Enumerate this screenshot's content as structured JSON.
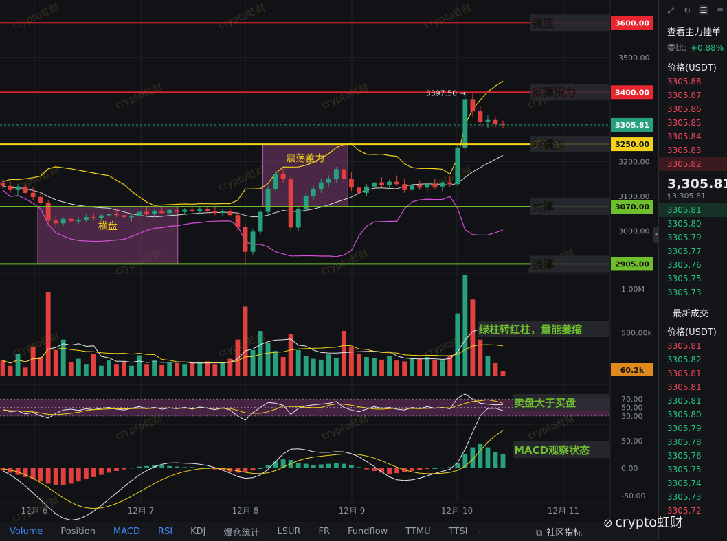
{
  "chart_data": {
    "type": "candlestick",
    "price_axis": {
      "ticks": [
        3000,
        3100,
        3200,
        3300,
        3400,
        3500
      ],
      "tick_labels": [
        "3000.00",
        "3100.00",
        "3200.00",
        "3300.00",
        "3400.00",
        "3500.00"
      ],
      "range": [
        2890,
        3650
      ]
    },
    "x_ticks": [
      "12月 6",
      "12月 7",
      "12月 8",
      "12月 9",
      "12月 10",
      "12月 11"
    ],
    "current_price": {
      "value": 3305.81,
      "label": "3305.81"
    },
    "high_marker": {
      "value": 3397.5,
      "label": "3397.50"
    },
    "levels": [
      {
        "name": "强压",
        "price": 3600,
        "price_label": "3600.00",
        "color": "#e8262f"
      },
      {
        "name": "反弹压力",
        "price": 3400,
        "price_label": "3400.00",
        "color": "#e8262f"
      },
      {
        "name": "关键位",
        "price": 3250,
        "price_label": "3250.00",
        "color": "#f2d21b"
      },
      {
        "name": "支撑",
        "price": 3070,
        "price_label": "3070.00",
        "color": "#6fbf2d"
      },
      {
        "name": "强撑",
        "price": 2905,
        "price_label": "2905.00",
        "color": "#6fbf2d"
      }
    ],
    "zones": [
      {
        "label": "横盘",
        "x0": 0.07,
        "x1": 0.35,
        "y0": 3070,
        "y1": 2905
      },
      {
        "label": "震荡蓄力",
        "x0": 0.52,
        "x1": 0.69,
        "y0": 3250,
        "y1": 3070
      }
    ],
    "candles": [
      [
        3140,
        3150,
        3120,
        3130
      ],
      [
        3130,
        3145,
        3110,
        3118
      ],
      [
        3118,
        3135,
        3100,
        3128
      ],
      [
        3128,
        3140,
        3105,
        3110
      ],
      [
        3110,
        3125,
        3090,
        3098
      ],
      [
        3098,
        3110,
        3075,
        3082
      ],
      [
        3082,
        3090,
        3015,
        3030
      ],
      [
        3030,
        3045,
        3010,
        3022
      ],
      [
        3022,
        3040,
        3015,
        3035
      ],
      [
        3035,
        3045,
        3022,
        3028
      ],
      [
        3028,
        3040,
        3020,
        3032
      ],
      [
        3032,
        3048,
        3025,
        3040
      ],
      [
        3040,
        3052,
        3032,
        3038
      ],
      [
        3038,
        3050,
        3028,
        3045
      ],
      [
        3045,
        3058,
        3035,
        3050
      ],
      [
        3050,
        3062,
        3040,
        3046
      ],
      [
        3046,
        3055,
        3030,
        3040
      ],
      [
        3040,
        3050,
        3028,
        3044
      ],
      [
        3044,
        3060,
        3038,
        3055
      ],
      [
        3055,
        3068,
        3045,
        3050
      ],
      [
        3050,
        3062,
        3040,
        3058
      ],
      [
        3058,
        3068,
        3048,
        3052
      ],
      [
        3052,
        3064,
        3044,
        3060
      ],
      [
        3060,
        3070,
        3050,
        3055
      ],
      [
        3055,
        3066,
        3048,
        3061
      ],
      [
        3061,
        3070,
        3052,
        3056
      ],
      [
        3056,
        3068,
        3048,
        3062
      ],
      [
        3062,
        3072,
        3052,
        3058
      ],
      [
        3058,
        3068,
        3046,
        3052
      ],
      [
        3052,
        3064,
        3042,
        3058
      ],
      [
        3058,
        3066,
        3040,
        3046
      ],
      [
        3046,
        3055,
        3000,
        3012
      ],
      [
        3012,
        3020,
        2905,
        2940
      ],
      [
        2940,
        3005,
        2930,
        2998
      ],
      [
        2998,
        3060,
        2990,
        3055
      ],
      [
        3055,
        3130,
        3048,
        3120
      ],
      [
        3120,
        3175,
        3110,
        3165
      ],
      [
        3165,
        3180,
        3140,
        3150
      ],
      [
        3150,
        3160,
        3000,
        3010
      ],
      [
        3010,
        3070,
        3000,
        3062
      ],
      [
        3062,
        3110,
        3055,
        3102
      ],
      [
        3102,
        3130,
        3090,
        3120
      ],
      [
        3120,
        3150,
        3110,
        3140
      ],
      [
        3140,
        3160,
        3125,
        3150
      ],
      [
        3150,
        3185,
        3140,
        3178
      ],
      [
        3178,
        3190,
        3140,
        3150
      ],
      [
        3150,
        3170,
        3115,
        3125
      ],
      [
        3125,
        3140,
        3100,
        3110
      ],
      [
        3110,
        3135,
        3100,
        3128
      ],
      [
        3128,
        3150,
        3115,
        3140
      ],
      [
        3140,
        3155,
        3125,
        3132
      ],
      [
        3132,
        3148,
        3120,
        3142
      ],
      [
        3142,
        3160,
        3130,
        3135
      ],
      [
        3135,
        3150,
        3110,
        3118
      ],
      [
        3118,
        3140,
        3108,
        3132
      ],
      [
        3132,
        3146,
        3118,
        3125
      ],
      [
        3125,
        3140,
        3112,
        3136
      ],
      [
        3136,
        3150,
        3120,
        3128
      ],
      [
        3128,
        3145,
        3115,
        3140
      ],
      [
        3140,
        3158,
        3128,
        3135
      ],
      [
        3135,
        3248,
        3130,
        3240
      ],
      [
        3240,
        3398,
        3230,
        3380
      ],
      [
        3380,
        3397.5,
        3330,
        3345
      ],
      [
        3345,
        3360,
        3300,
        3315
      ],
      [
        3315,
        3335,
        3295,
        3320
      ],
      [
        3320,
        3330,
        3300,
        3308
      ],
      [
        3308,
        3318,
        3298,
        3305.81
      ]
    ],
    "volume": {
      "axis_ticks": [
        "1.00M",
        "500.00k"
      ],
      "axis_values": [
        1000000,
        500000
      ],
      "range": [
        0,
        1150000
      ],
      "current_label": "60.2k",
      "values": [
        180,
        120,
        260,
        100,
        340,
        220,
        960,
        300,
        420,
        160,
        200,
        140,
        260,
        120,
        180,
        140,
        160,
        120,
        240,
        140,
        180,
        130,
        160,
        150,
        140,
        160,
        150,
        170,
        140,
        160,
        200,
        420,
        800,
        300,
        520,
        380,
        290,
        220,
        480,
        300,
        230,
        200,
        190,
        250,
        210,
        520,
        340,
        260,
        220,
        210,
        190,
        230,
        180,
        170,
        210,
        200,
        220,
        190,
        180,
        240,
        720,
        1160,
        880,
        420,
        230,
        150,
        60
      ],
      "annotation": "绿柱转红柱，量能萎缩"
    },
    "rsi": {
      "axis_ticks": [
        "70.00",
        "50.00",
        "30.00"
      ],
      "axis_values": [
        70,
        50,
        30
      ],
      "range": [
        20,
        85
      ],
      "values": [
        45,
        40,
        42,
        35,
        38,
        30,
        25,
        36,
        44,
        46,
        43,
        47,
        45,
        48,
        50,
        46,
        44,
        48,
        52,
        47,
        50,
        46,
        49,
        47,
        50,
        46,
        51,
        48,
        45,
        49,
        44,
        30,
        20,
        38,
        50,
        62,
        60,
        55,
        34,
        48,
        54,
        56,
        58,
        60,
        64,
        50,
        44,
        40,
        46,
        52,
        48,
        50,
        46,
        44,
        50,
        47,
        52,
        48,
        50,
        47,
        72,
        82,
        70,
        60,
        58,
        56,
        57
      ],
      "annotation": "卖盘大于买盘"
    },
    "macd": {
      "axis_ticks": [
        "50.00",
        "0.00",
        "-50.00"
      ],
      "axis_values": [
        50,
        0,
        -50
      ],
      "range": [
        -60,
        75
      ],
      "hist": [
        -4,
        -8,
        -12,
        -16,
        -20,
        -24,
        -28,
        -30,
        -30,
        -28,
        -24,
        -20,
        -16,
        -12,
        -8,
        -5,
        -2,
        1,
        3,
        4,
        5,
        5,
        4,
        3,
        2,
        2,
        1,
        0,
        -2,
        -4,
        -6,
        -8,
        -7,
        -4,
        0,
        6,
        12,
        16,
        15,
        10,
        8,
        6,
        7,
        8,
        9,
        8,
        5,
        2,
        -2,
        -5,
        -8,
        -10,
        -9,
        -7,
        -5,
        -3,
        -1,
        0,
        1,
        2,
        10,
        25,
        38,
        45,
        38,
        30,
        26
      ],
      "annotation": "MACD观察状态"
    }
  },
  "tabs": [
    {
      "label": "Volume",
      "active": true
    },
    {
      "label": "Position",
      "active": false
    },
    {
      "label": "MACD",
      "active": true
    },
    {
      "label": "RSI",
      "active": true
    },
    {
      "label": "KDJ",
      "active": false
    },
    {
      "label": "爆仓统计",
      "active": false
    },
    {
      "label": "LSUR",
      "active": false
    },
    {
      "label": "FR",
      "active": false
    },
    {
      "label": "Fundflow",
      "active": false
    },
    {
      "label": "TTMU",
      "active": false
    },
    {
      "label": "TTSI",
      "active": false
    }
  ],
  "tabs_more": "·",
  "community_label": "社区指标",
  "brand_text": "crypto虹财",
  "watermark_text": "crypto虹财",
  "panel": {
    "title": "查看主力挂单",
    "ratio_label": "委比:",
    "ratio_value": "+0.88%",
    "price_header": "价格(USDT)",
    "asks": [
      "3305.88",
      "3305.87",
      "3305.86",
      "3305.85",
      "3305.84",
      "3305.83",
      "3305.82"
    ],
    "last_price": "3,305.81",
    "last_usd": "$3,305.81",
    "bids": [
      "3305.81",
      "3305.80",
      "3305.79",
      "3305.77",
      "3305.76",
      "3305.75",
      "3305.73"
    ],
    "recent_header": "最新成交",
    "trades_header": "价格(USDT)",
    "trades": [
      {
        "p": "3305.81",
        "s": "ask"
      },
      {
        "p": "3305.82",
        "s": "bid"
      },
      {
        "p": "3305.81",
        "s": "ask"
      },
      {
        "p": "3305.81",
        "s": "ask"
      },
      {
        "p": "3305.81",
        "s": "bid"
      },
      {
        "p": "3305.80",
        "s": "bid"
      },
      {
        "p": "3305.79",
        "s": "bid"
      },
      {
        "p": "3305.78",
        "s": "bid"
      },
      {
        "p": "3305.76",
        "s": "bid"
      },
      {
        "p": "3305.75",
        "s": "bid"
      },
      {
        "p": "3305.74",
        "s": "bid"
      },
      {
        "p": "3305.73",
        "s": "bid"
      },
      {
        "p": "3305.72",
        "s": "ask"
      }
    ]
  },
  "colors": {
    "up": "#26a17b",
    "down": "#e2403e",
    "bb": "#f2d21b",
    "bbmid": "#d8d8d8",
    "bblow": "#d64fd6",
    "zone": "#7a3b6e"
  }
}
